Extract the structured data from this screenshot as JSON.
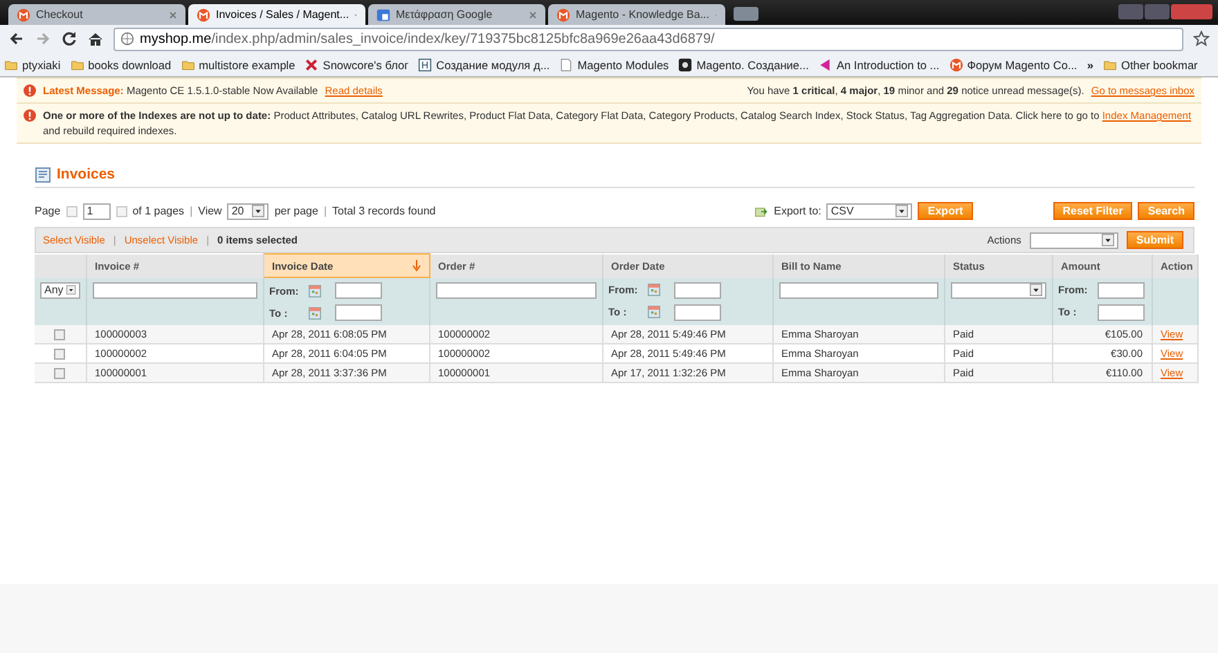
{
  "browser": {
    "tabs": [
      {
        "label": "Checkout",
        "selected": false
      },
      {
        "label": "Invoices / Sales / Magent...",
        "selected": true
      },
      {
        "label": "Μετάφραση Google",
        "selected": false
      },
      {
        "label": "Magento - Knowledge Ba...",
        "selected": false
      }
    ],
    "address": {
      "host": "myshop.me",
      "path": "/index.php/admin/sales_invoice/index/key/719375bc8125bfc8a969e26aa43d6879/"
    },
    "bookmarks": [
      "ptyxiaki",
      "books download",
      "multistore example",
      "Snowcore's блог",
      "Создание модуля д...",
      "Magento Modules",
      "Magento. Создание...",
      "An Introduction to ...",
      "Форум Magento Co..."
    ],
    "more": "»",
    "other": "Other bookmar"
  },
  "messages": {
    "latest": {
      "title": "Latest Message:",
      "text": "Magento CE 1.5.1.0-stable Now Available",
      "link": "Read details",
      "summary": "You have **1 critical**, **4 major**, **19** minor and **29** notice unread message(s).",
      "summary_link": "Go to messages inbox"
    },
    "index": {
      "text": "**One or more of the Indexes are not up to date:** Product Attributes, Catalog URL Rewrites, Product Flat Data, Category Flat Data, Category Products, Catalog Search Index, Stock Status, Tag Aggregation Data. Click here to go to",
      "link": "Index Management",
      "after": "and rebuild required indexes."
    }
  },
  "page_title": "Invoices",
  "pager": {
    "page_label": "Page",
    "page": "1",
    "of_pages": "of 1 pages",
    "separator_1": "|",
    "view_label": "View",
    "per_page": "20",
    "per_page_label": "per page",
    "separator_2": "|",
    "total": "Total 3 records found",
    "export_label": "Export to:",
    "export_format": "CSV",
    "export_button": "Export",
    "reset_button": "Reset Filter",
    "search_button": "Search"
  },
  "massaction": {
    "select_visible": "Select Visible",
    "separator_1": "|",
    "unselect_visible": "Unselect Visible",
    "separator_2": "|",
    "selected": "0 items selected",
    "actions_label": "Actions",
    "submit": "Submit"
  },
  "table": {
    "columns": [
      {
        "label": "Invoice #",
        "sorted": false
      },
      {
        "label": "Invoice Date",
        "sorted": true
      },
      {
        "label": "Order #",
        "sorted": false
      },
      {
        "label": "Order Date",
        "sorted": false
      },
      {
        "label": "Bill to Name",
        "sorted": false
      },
      {
        "label": "Status",
        "sorted": false
      },
      {
        "label": "Amount",
        "sorted": false
      },
      {
        "label": "Action",
        "sorted": false
      }
    ],
    "filters": [
      {
        "kind": "select",
        "value": "Any"
      },
      {
        "kind": "text"
      },
      {
        "kind": "date",
        "from_label": "From:",
        "to_label": "To :"
      },
      {
        "kind": "text"
      },
      {
        "kind": "date",
        "from_label": "From:",
        "to_label": "To :"
      },
      {
        "kind": "text"
      },
      {
        "kind": "select"
      },
      {
        "kind": "range",
        "from_label": "From:",
        "to_label": "To :"
      },
      {
        "kind": "none"
      }
    ],
    "rows": [
      {
        "checked": false,
        "cells": [
          "100000003",
          "Apr 28, 2011 6:08:05 PM",
          "100000002",
          "Apr 28, 2011 5:49:46 PM",
          "Emma Sharoyan",
          "Paid",
          "€105.00",
          "View"
        ]
      },
      {
        "checked": false,
        "cells": [
          "100000002",
          "Apr 28, 2011 6:04:05 PM",
          "100000002",
          "Apr 28, 2011 5:49:46 PM",
          "Emma Sharoyan",
          "Paid",
          "€30.00",
          "View"
        ]
      },
      {
        "checked": false,
        "cells": [
          "100000001",
          "Apr 28, 2011 3:37:36 PM",
          "100000001",
          "Apr 17, 2011 1:32:26 PM",
          "Emma Sharoyan",
          "Paid",
          "€110.00",
          "View"
        ]
      }
    ]
  }
}
